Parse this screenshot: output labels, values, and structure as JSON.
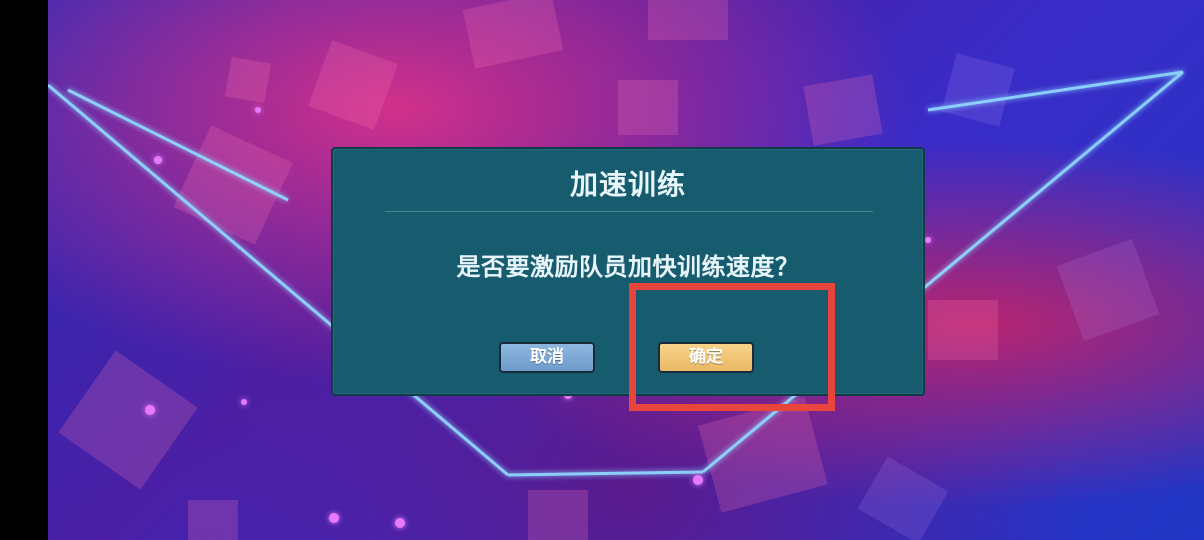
{
  "dialog": {
    "title": "加速训练",
    "message": "是否要激励队员加快训练速度？",
    "cancel_label": "取消",
    "confirm_label": "确定"
  },
  "colors": {
    "dialog_bg": "#175c6e",
    "cancel_button": "#7fa8d6",
    "confirm_button": "#f0c575",
    "highlight": "#e8463c"
  }
}
